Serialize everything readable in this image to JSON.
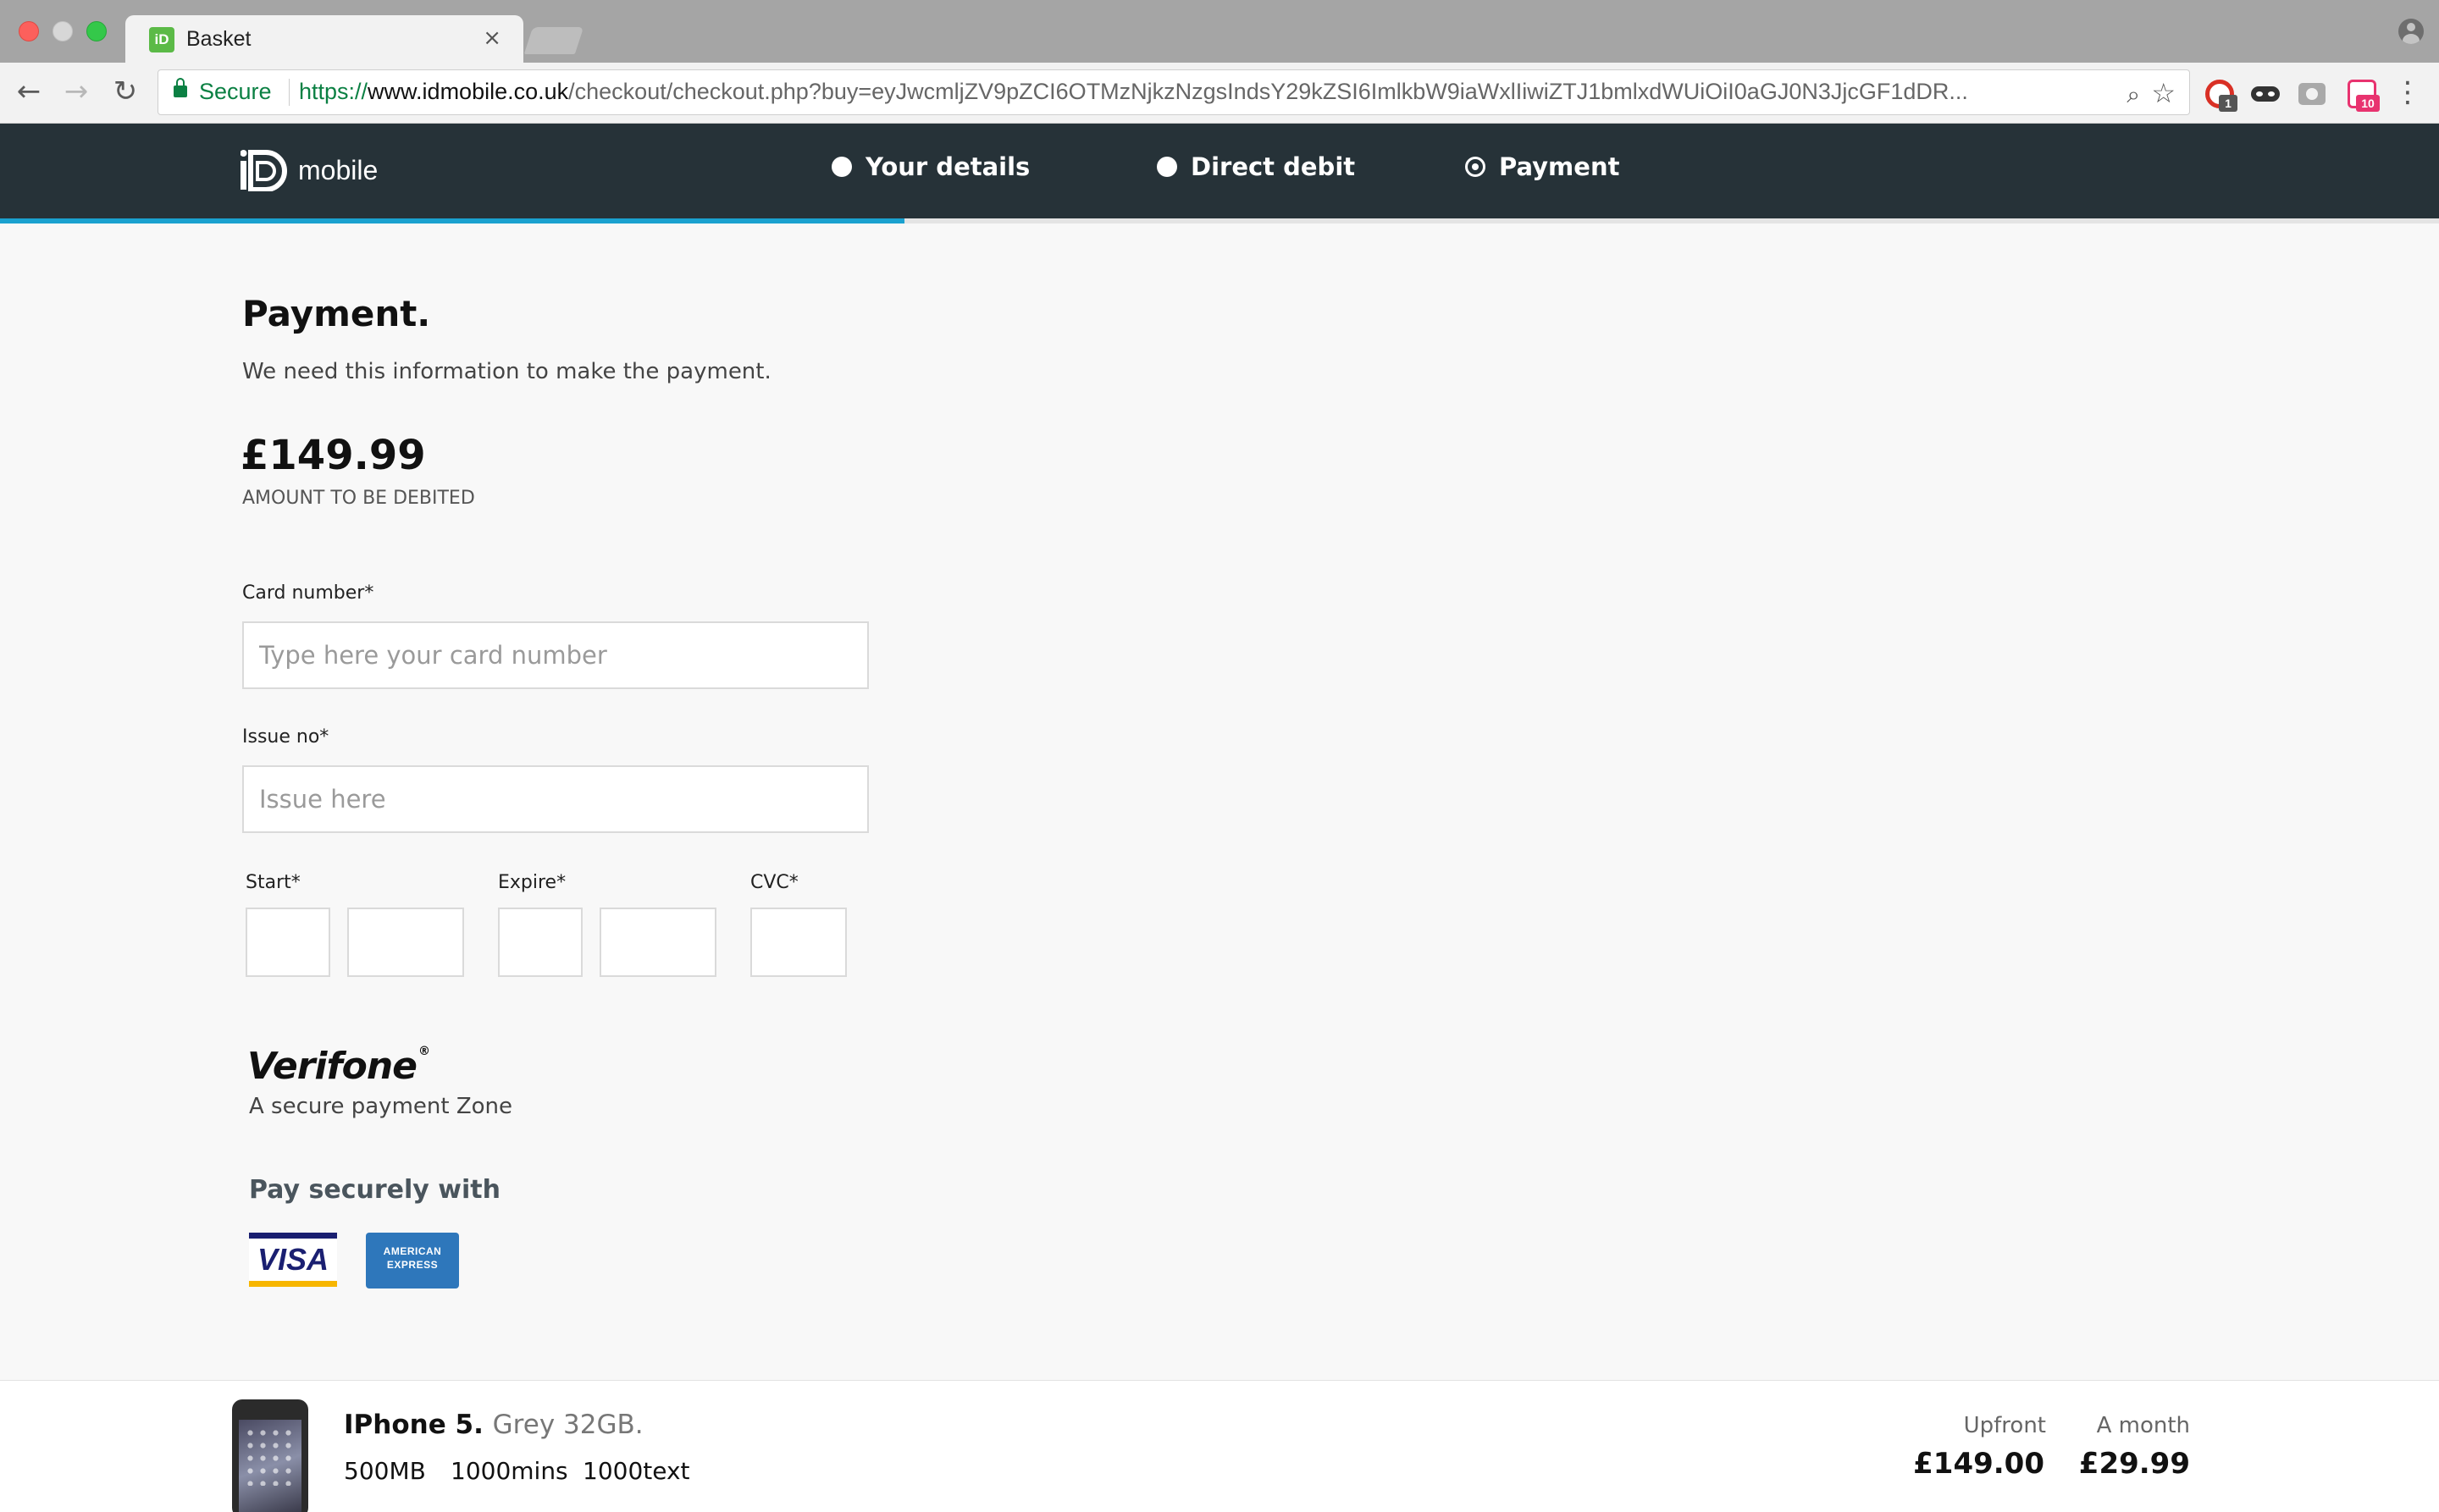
{
  "browser": {
    "tab_title": "Basket",
    "tab_close": "×",
    "secure_label": "Secure",
    "url_scheme": "https://",
    "url_host": "www.idmobile.co.uk",
    "url_path": "/checkout/checkout.php?buy=eyJwcmljZV9pZCI6OTMzNjkzNzgsIndsY29kZSI6ImlkbW9iaWxlIiwiZTJ1bmlxdWUiOiI0aGJ0N3JjcGF1dDR...",
    "extension_badges": {
      "red": "1",
      "pink": "10"
    },
    "icons": [
      "back-arrow-icon",
      "forward-arrow-icon",
      "reload-icon",
      "lock-icon",
      "zoom-icon",
      "star-icon",
      "menu-icon",
      "profile-icon"
    ]
  },
  "header": {
    "brand": "mobile",
    "steps": [
      {
        "label": "Your details",
        "state": "complete"
      },
      {
        "label": "Direct debit",
        "state": "complete"
      },
      {
        "label": "Payment",
        "state": "current"
      }
    ],
    "progress_fraction": 0.371,
    "colors": {
      "header_bg": "#263238",
      "progress": "#1aa1cf"
    }
  },
  "payment": {
    "title": "Payment.",
    "subtitle": "We need this information to make the payment.",
    "amount": "£149.99",
    "amount_caption": "AMOUNT TO BE DEBITED",
    "card_number": {
      "label": "Card number*",
      "placeholder": "Type here your card number",
      "value": ""
    },
    "issue_no": {
      "label": "Issue no*",
      "placeholder": "Issue here",
      "value": ""
    },
    "start_label": "Start*",
    "expire_label": "Expire*",
    "cvc_label": "CVC*"
  },
  "security": {
    "verifone_logo": "Verifone",
    "tagline": "A secure payment Zone",
    "pay_heading": "Pay securely with",
    "cards": {
      "visa": "VISA",
      "amex_line1": "AMERICAN",
      "amex_line2": "EXPRESS"
    }
  },
  "summary": {
    "product_name": "IPhone 5.",
    "product_variant": "Grey 32GB.",
    "data": "500MB",
    "minutes": "1000mins",
    "texts": "1000text",
    "upfront_label": "Upfront",
    "upfront_price": "£149.00",
    "monthly_label": "A month",
    "monthly_price": "£29.99"
  }
}
